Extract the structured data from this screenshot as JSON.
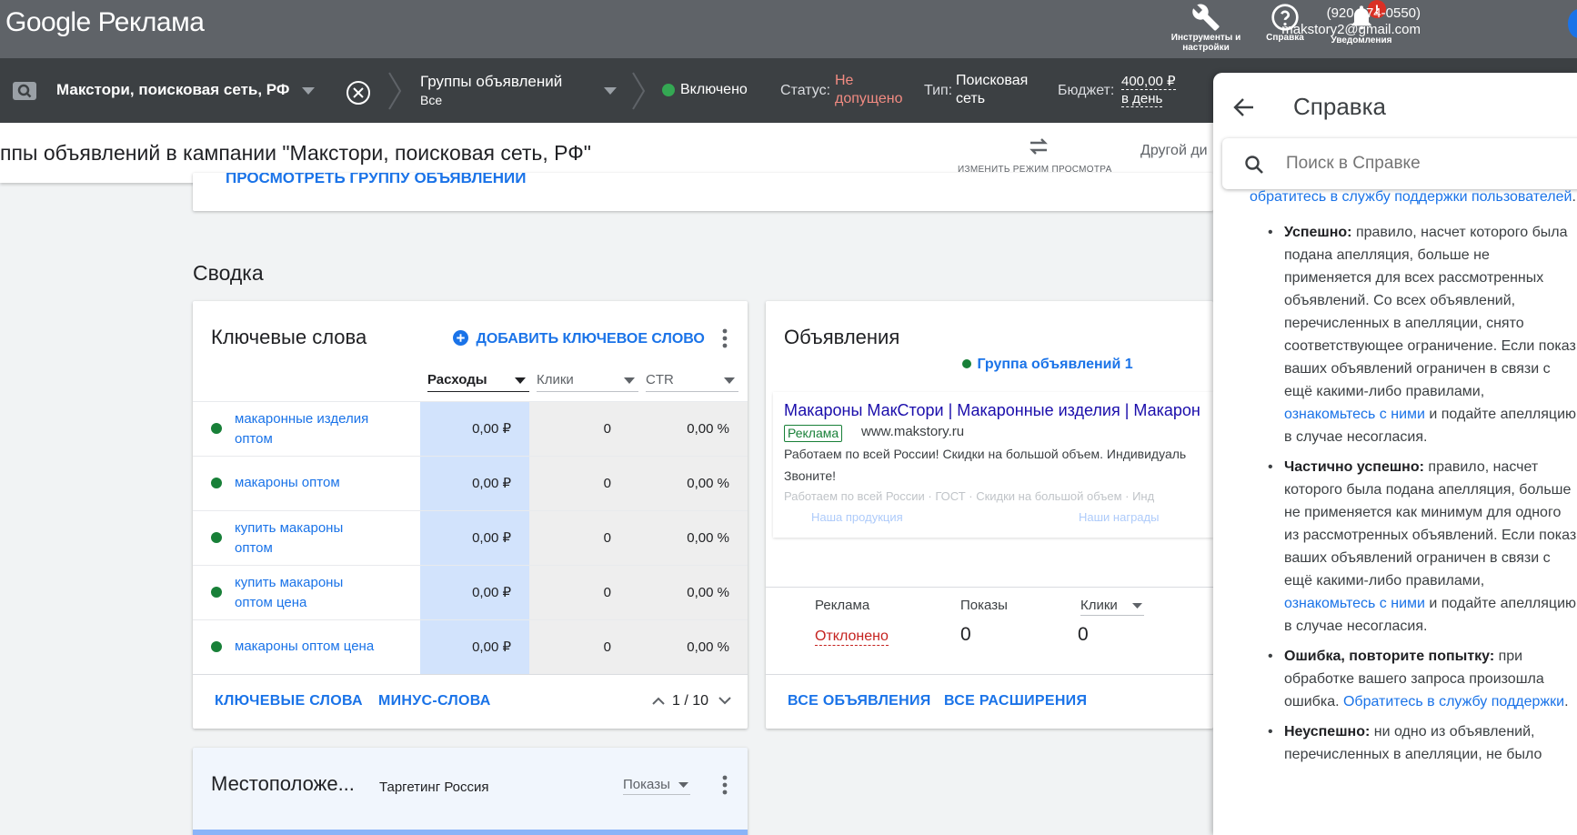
{
  "header": {
    "logo": "Google Реклама",
    "tools_label": "Инструменты и настройки",
    "help_label": "Справка",
    "notifications_label": "Уведомления",
    "notifications_badge": "!",
    "phone": "(920-074-0550)",
    "email": "makstory2@gmail.com"
  },
  "campaign_bar": {
    "campaign": "Макстори, поисковая сеть, РФ",
    "ad_groups_title": "Группы объявлений",
    "ad_groups_value": "Все",
    "state": "Включено",
    "status_label": "Статус:",
    "status_value_1": "Не",
    "status_value_2": "допущено",
    "type_label": "Тип:",
    "type_value_1": "Поисковая",
    "type_value_2": "сеть",
    "budget_label": "Бюджет:",
    "budget_value_1": "400,00 ₽",
    "budget_value_2": "в день"
  },
  "page": {
    "title": "ппы объявлений в кампании \"Макстори, поисковая сеть, РФ\"",
    "change_view": "ИЗМЕНИТЬ РЕЖИМ ПРОСМОТРА",
    "other_range": "Другой ди",
    "partial_link": "ПРОСМОТРЕТЬ ГРУППУ ОБЪЯВЛЕНИЙ",
    "summary": "Сводка"
  },
  "keywords_card": {
    "title": "Ключевые слова",
    "add_button": "ДОБАВИТЬ КЛЮЧЕВОЕ СЛОВО",
    "columns": [
      "Расходы",
      "Клики",
      "CTR"
    ],
    "rows": [
      {
        "keyword": "макаронные изделия оптом",
        "cost": "0,00 ₽",
        "clicks": "0",
        "ctr": "0,00 %"
      },
      {
        "keyword": "макароны оптом",
        "cost": "0,00 ₽",
        "clicks": "0",
        "ctr": "0,00 %"
      },
      {
        "keyword": "купить макароны оптом",
        "cost": "0,00 ₽",
        "clicks": "0",
        "ctr": "0,00 %"
      },
      {
        "keyword": "купить макароны оптом цена",
        "cost": "0,00 ₽",
        "clicks": "0",
        "ctr": "0,00 %"
      },
      {
        "keyword": "макароны оптом цена",
        "cost": "0,00 ₽",
        "clicks": "0",
        "ctr": "0,00 %"
      }
    ],
    "footer_keywords": "КЛЮЧЕВЫЕ СЛОВА",
    "footer_negative": "МИНУС-СЛОВА",
    "pagination": "1 / 10"
  },
  "ads_card": {
    "title": "Объявления",
    "ad_group": "Группа объявлений 1",
    "ad_headline": "Макароны МакСтори | Макаронные изделия | Макарон",
    "ad_badge": "Реклама",
    "ad_url": "www.makstory.ru",
    "ad_description_1": "Работаем по всей России! Скидки на большой объем. Индивидуаль",
    "ad_description_2": "Звоните!",
    "ad_callouts": "Работаем по всей России · ГОСТ · Скидки на большой объем · Инд",
    "sitelink_1": "Наша продукция",
    "sitelink_2": "Наши награды",
    "col_ad": "Реклама",
    "col_impr": "Показы",
    "col_clicks": "Клики",
    "ad_status": "Отклонено",
    "impr_value": "0",
    "clicks_value": "0",
    "footer_all_ads": "ВСЕ ОБЪЯВЛЕНИЯ",
    "footer_all_ext": "ВСЕ РАСШИРЕНИЯ"
  },
  "location_card": {
    "title": "Местоположе...",
    "targeting": "Таргетинг Россия",
    "metric": "Показы"
  },
  "help_panel": {
    "title": "Справка",
    "search_placeholder": "Поиск в Справке",
    "intro_link": "обратитесь в службу поддержки пользователей",
    "intro_end": ".",
    "items": [
      {
        "bold": "Успешно:",
        "text": " правило, насчет которого была подана апелляция, больше не применяется для всех рассмотренных объявлений. Со всех объявлений, перечисленных в апелляции, снято соответствующее ограничение. Если показ ваших объявлений ограничен в связи с ещё какими-либо правилами, ",
        "link": "ознакомьтесь с ними",
        "tail": " и подайте апелляцию в случае несогласия."
      },
      {
        "bold": "Частично успешно:",
        "text": " правило, насчет которого была подана апелляция, больше не применяется как минимум для одного из рассмотренных объявлений. Если показ ваших объявлений ограничен в связи с ещё какими-либо правилами, ",
        "link": "ознакомьтесь с ними",
        "tail": " и подайте апелляцию в случае несогласия."
      },
      {
        "bold": "Ошибка, повторите попытку:",
        "text": " при обработке вашего запроса произошла ошибка. ",
        "link": "Обратитесь в службу поддержки",
        "tail": "."
      },
      {
        "bold": "Неуспешно:",
        "text": " ни одно из объявлений, перечисленных в апелляции, не было",
        "link": "",
        "tail": ""
      }
    ]
  },
  "colors": {
    "header_bg": "#5f6368",
    "campaign_bar_bg": "#3c4043",
    "link_blue": "#1a73e8",
    "enabled_green": "#188038",
    "rejected_red": "#c5221f",
    "status_orange": "#f28b82",
    "cost_column_bg": "#d2e3fc"
  }
}
